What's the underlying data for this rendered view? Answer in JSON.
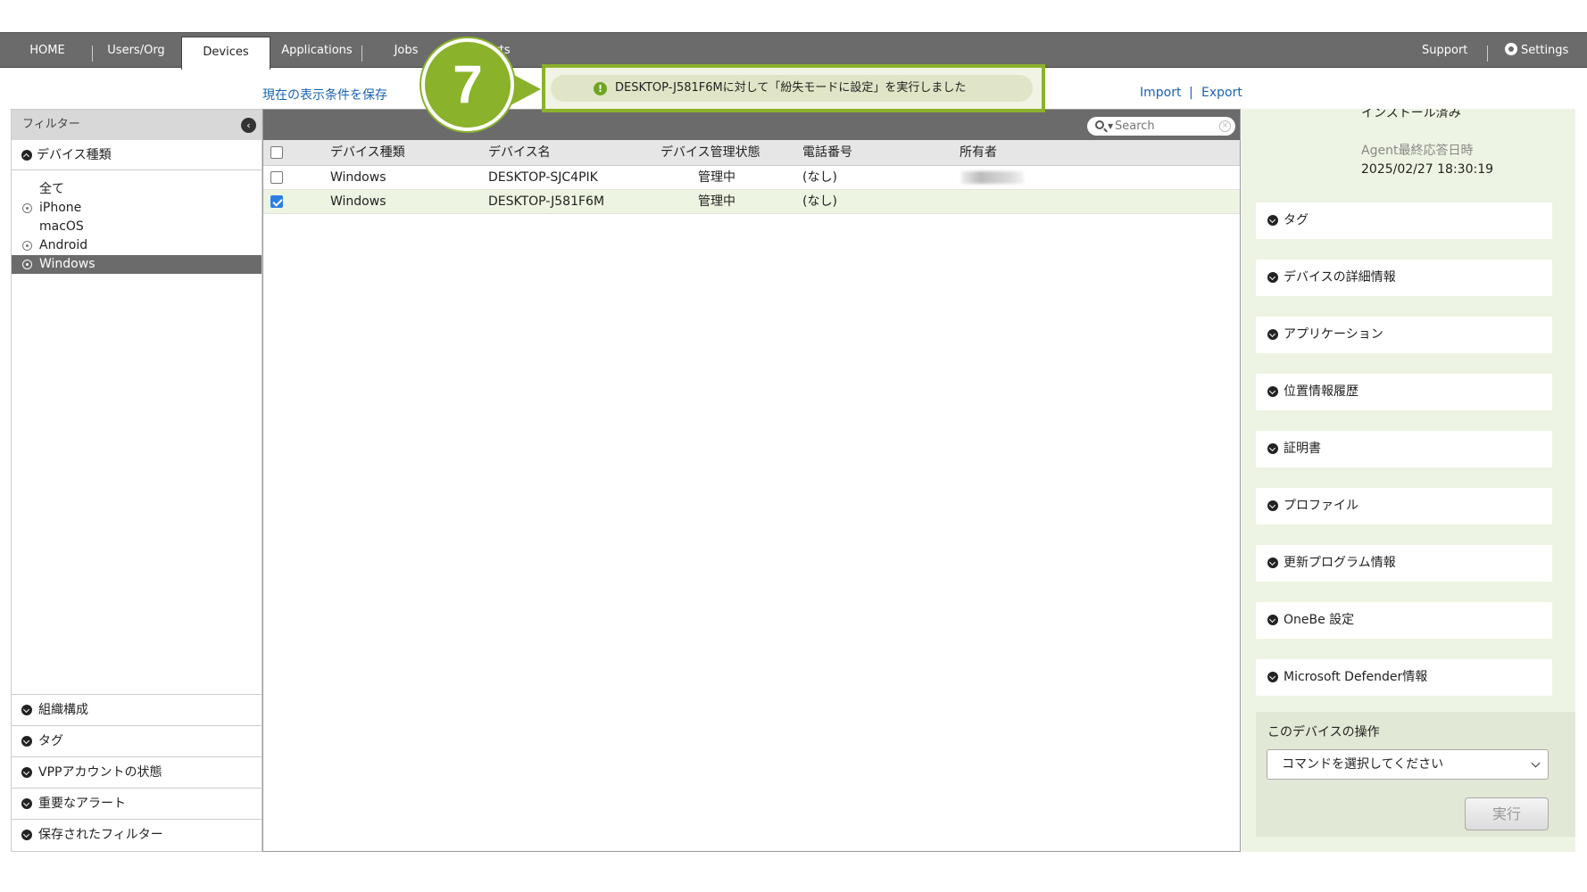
{
  "nav": {
    "tabs": [
      {
        "label": "HOME"
      },
      {
        "label": "Users/Org"
      },
      {
        "label": "Devices"
      },
      {
        "label": "Applications"
      },
      {
        "label": "Jobs"
      },
      {
        "label": "rts"
      }
    ],
    "support_label": "Support",
    "settings_label": "Settings"
  },
  "actions": {
    "save_view_label": "現在の表示条件を保存",
    "import_label": "Import",
    "separator": "|",
    "export_label": "Export"
  },
  "callout": {
    "step_number": "7",
    "toast_icon": "!",
    "toast_message": "DESKTOP-J581F6Mに対して「紛失モードに設定」を実行しました"
  },
  "filter": {
    "header": "フィルター",
    "device_type_heading": "デバイス種類",
    "device_types": [
      {
        "label": "全て",
        "has_radio": false,
        "selected": false
      },
      {
        "label": "iPhone",
        "has_radio": true,
        "selected": false
      },
      {
        "label": "macOS",
        "has_radio": false,
        "selected": false
      },
      {
        "label": "Android",
        "has_radio": true,
        "selected": false
      },
      {
        "label": "Windows",
        "has_radio": true,
        "selected": true
      }
    ],
    "bottom_sections": [
      "組織構成",
      "タグ",
      "VPPアカウントの状態",
      "重要なアラート",
      "保存されたフィルター"
    ]
  },
  "table": {
    "search_placeholder": "Search",
    "columns": [
      "デバイス種類",
      "デバイス名",
      "デバイス管理状態",
      "電話番号",
      "所有者"
    ],
    "rows": [
      {
        "type": "Windows",
        "name": "DESKTOP-SJC4PIK",
        "status": "管理中",
        "phone": "(なし)",
        "owner_blurred": true,
        "checked": false
      },
      {
        "type": "Windows",
        "name": "DESKTOP-J581F6M",
        "status": "管理中",
        "phone": "(なし)",
        "owner_blurred": false,
        "checked": true
      }
    ]
  },
  "detail": {
    "install_status": "インストール済み",
    "agent_label": "Agent最終応答日時",
    "agent_datetime": "2025/02/27 18:30:19",
    "sections": [
      "タグ",
      "デバイスの詳細情報",
      "アプリケーション",
      "位置情報履歴",
      "証明書",
      "プロファイル",
      "更新プログラム情報",
      "OneBe 設定",
      "Microsoft Defender情報"
    ],
    "operations": {
      "title": "このデバイスの操作",
      "select_placeholder": "コマンドを選択してください",
      "run_label": "実行"
    }
  },
  "colors": {
    "nav_bg": "#6b6b6b",
    "accent_green": "#8ab22a",
    "link_blue": "#1a63b0",
    "detail_bg": "#eef4e3",
    "selected_row": "#edf4e2"
  }
}
